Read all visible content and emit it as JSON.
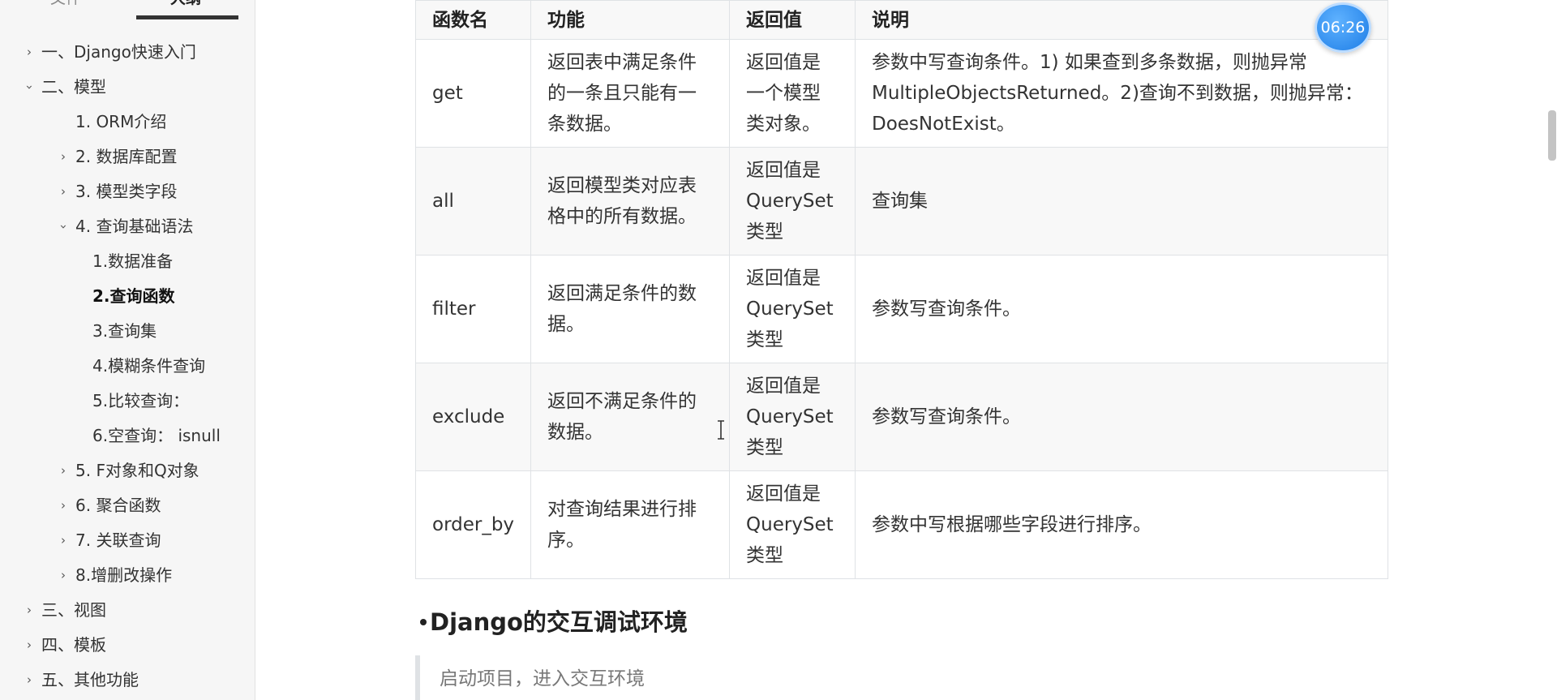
{
  "sidebar": {
    "tabs": [
      {
        "label": "文件",
        "active": false
      },
      {
        "label": "大纲",
        "active": true
      }
    ],
    "items": [
      {
        "label": "一、Django快速入门",
        "level": 1,
        "expanded": false
      },
      {
        "label": "二、模型",
        "level": 1,
        "expanded": true
      },
      {
        "label": "1. ORM介绍",
        "level": 2
      },
      {
        "label": "2. 数据库配置",
        "level": 2,
        "expanded": false
      },
      {
        "label": "3. 模型类字段",
        "level": 2,
        "expanded": false
      },
      {
        "label": "4. 查询基础语法",
        "level": 2,
        "expanded": true
      },
      {
        "label": "1.数据准备",
        "level": 3
      },
      {
        "label": "2.查询函数",
        "level": 3,
        "active": true
      },
      {
        "label": "3.查询集",
        "level": 3
      },
      {
        "label": "4.模糊条件查询",
        "level": 3
      },
      {
        "label": "5.比较查询：",
        "level": 3
      },
      {
        "label": "6.空查询： isnull",
        "level": 3
      },
      {
        "label": "5. F对象和Q对象",
        "level": 2,
        "expanded": false
      },
      {
        "label": "6. 聚合函数",
        "level": 2,
        "expanded": false
      },
      {
        "label": "7. 关联查询",
        "level": 2,
        "expanded": false
      },
      {
        "label": "8.增删改操作",
        "level": 2,
        "expanded": false
      },
      {
        "label": "三、视图",
        "level": 1,
        "expanded": false
      },
      {
        "label": "四、模板",
        "level": 1,
        "expanded": false
      },
      {
        "label": "五、其他功能",
        "level": 1,
        "expanded": false
      }
    ]
  },
  "table": {
    "headers": [
      "函数名",
      "功能",
      "返回值",
      "说明"
    ],
    "rows": [
      {
        "name": "get",
        "func": "返回表中满足条件的一条且只能有一条数据。",
        "ret": "返回值是一个模型类对象。",
        "desc": "参数中写查询条件。1) 如果查到多条数据，则抛异常MultipleObjectsReturned。2)查询不到数据，则抛异常：DoesNotExist。"
      },
      {
        "name": "all",
        "func": "返回模型类对应表格中的所有数据。",
        "ret": "返回值是QuerySet类型",
        "desc": "查询集"
      },
      {
        "name": "filter",
        "func": "返回满足条件的数据。",
        "ret": "返回值是QuerySet类型",
        "desc": "参数写查询条件。"
      },
      {
        "name": "exclude",
        "func": "返回不满足条件的数据。",
        "ret": "返回值是QuerySet类型",
        "desc": "参数写查询条件。"
      },
      {
        "name": "order_by",
        "func": "对查询结果进行排序。",
        "ret": "返回值是QuerySet类型",
        "desc": "参数中写根据哪些字段进行排序。"
      }
    ]
  },
  "section": {
    "heading": "Django的交互调试环境",
    "quote": "启动项目，进入交互环境"
  },
  "timer": {
    "text": "06:26"
  },
  "colors": {
    "sidebar_bg": "#f6f6f6",
    "table_border": "#dfe2e5",
    "timer_blue": "#1d7de6"
  }
}
